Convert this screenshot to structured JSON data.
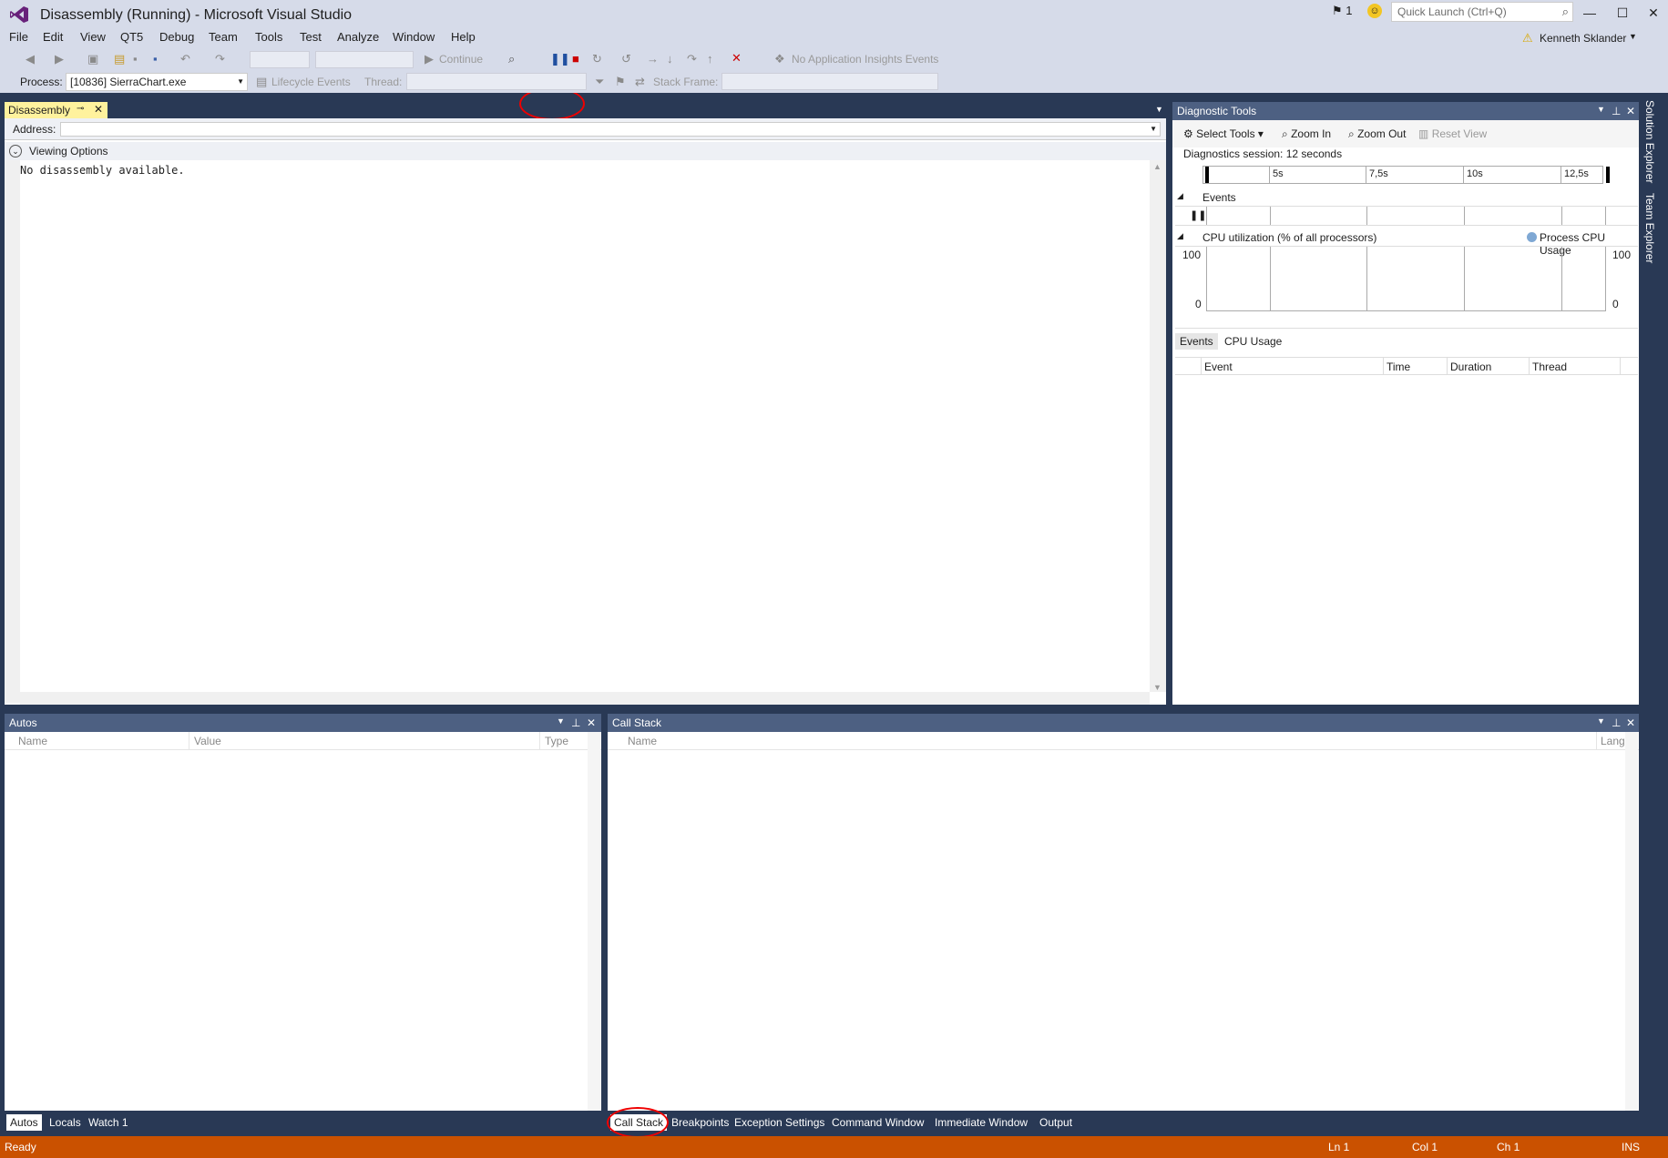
{
  "window": {
    "title": "Disassembly (Running) - Microsoft Visual Studio",
    "notification_count": "1",
    "quick_launch_placeholder": "Quick Launch (Ctrl+Q)",
    "user": "Kenneth Sklander"
  },
  "menu": [
    "File",
    "Edit",
    "View",
    "QT5",
    "Debug",
    "Team",
    "Tools",
    "Test",
    "Analyze",
    "Window",
    "Help"
  ],
  "toolbar": {
    "continue_label": "Continue",
    "app_insights": "No Application Insights Events",
    "process_label": "Process:",
    "process_value": "[10836] SierraChart.exe",
    "lifecycle_label": "Lifecycle Events",
    "thread_label": "Thread:",
    "stack_frame_label": "Stack Frame:"
  },
  "disassembly": {
    "tab_label": "Disassembly",
    "address_label": "Address:",
    "viewing_options": "Viewing Options",
    "content": "No disassembly available."
  },
  "diagnostic_tools": {
    "title": "Diagnostic Tools",
    "select_tools": "Select Tools",
    "zoom_in": "Zoom In",
    "zoom_out": "Zoom Out",
    "reset_view": "Reset View",
    "session": "Diagnostics session: 12 seconds",
    "ticks": [
      "5s",
      "7,5s",
      "10s",
      "12,5s"
    ],
    "events_label": "Events",
    "cpu_label": "CPU utilization (% of all processors)",
    "cpu_legend": "Process CPU Usage",
    "cpu_max": "100",
    "cpu_min": "0",
    "tabs": [
      "Events",
      "CPU Usage"
    ],
    "columns": [
      "Event",
      "Time",
      "Duration",
      "Thread"
    ]
  },
  "autos": {
    "title": "Autos",
    "columns": [
      "Name",
      "Value",
      "Type"
    ]
  },
  "call_stack": {
    "title": "Call Stack",
    "columns": [
      "Name",
      "Lang"
    ]
  },
  "bottom_tabs_left": [
    "Autos",
    "Locals",
    "Watch 1"
  ],
  "bottom_tabs_right": [
    "Call Stack",
    "Breakpoints",
    "Exception Settings",
    "Command Window",
    "Immediate Window",
    "Output"
  ],
  "side_tabs": [
    "Solution Explorer",
    "Team Explorer"
  ],
  "status": {
    "ready": "Ready",
    "ln": "Ln 1",
    "col": "Col 1",
    "ch": "Ch 1",
    "ins": "INS"
  },
  "colors": {
    "accent": "#ca5100",
    "panel_header": "#4d6082",
    "chrome": "#d6dbe9",
    "active_tab": "#fff29d"
  }
}
